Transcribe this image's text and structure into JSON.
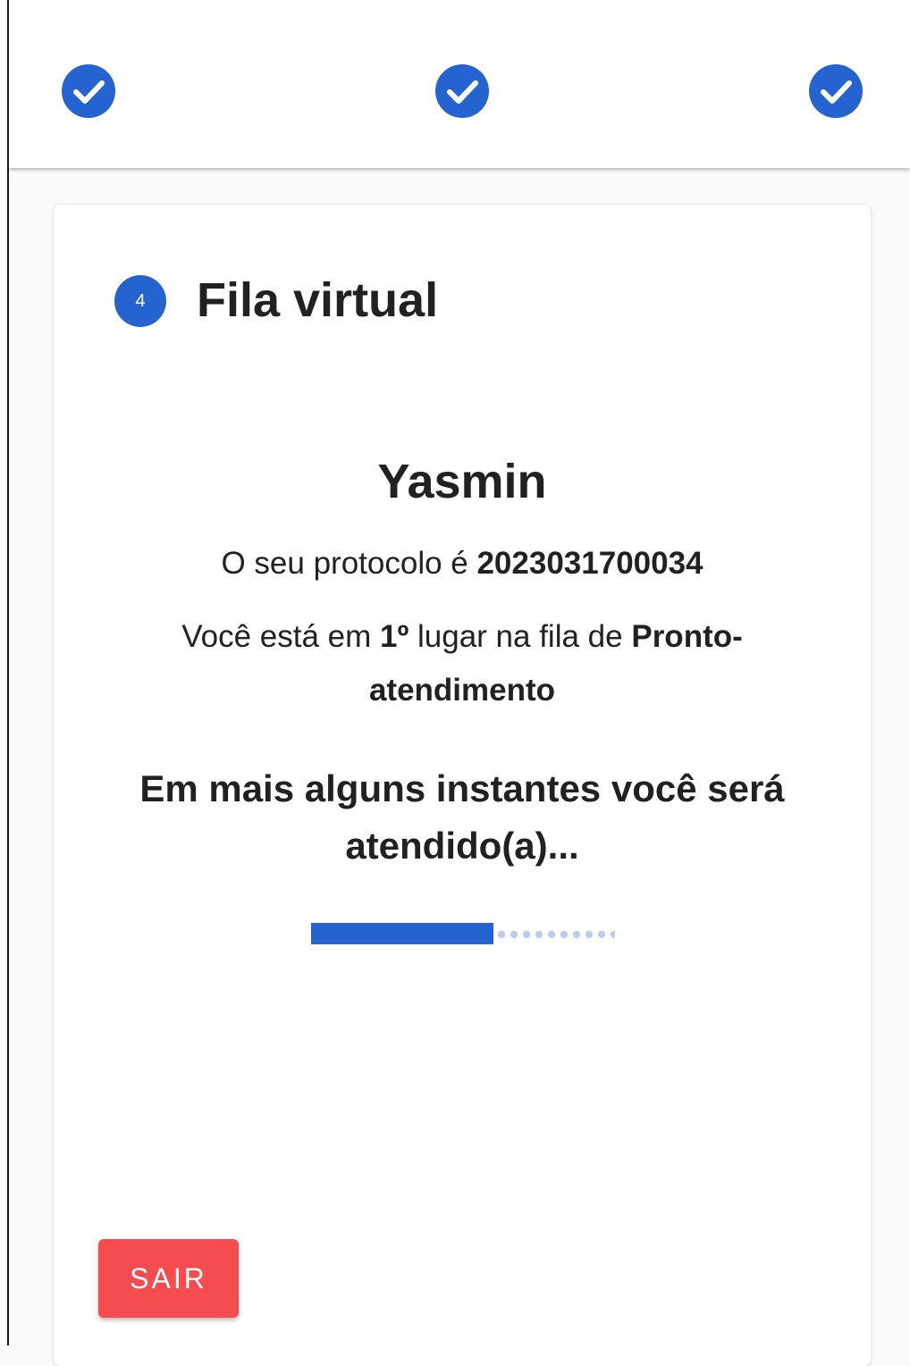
{
  "stepper": {
    "steps": [
      {
        "status": "completed",
        "icon": "check-circle-icon"
      },
      {
        "status": "completed",
        "icon": "check-circle-icon"
      },
      {
        "status": "completed",
        "icon": "check-circle-icon"
      }
    ]
  },
  "card": {
    "step_number": "4",
    "title": "Fila virtual",
    "patient_name": "Yasmin",
    "protocol_prefix": "O seu protocolo é ",
    "protocol_number": "2023031700034",
    "queue_prefix": "Você está em ",
    "queue_position": "1º",
    "queue_middle": " lugar na fila de ",
    "queue_name": "Pronto-atendimento",
    "wait_message": "Em mais alguns instantes você será atendido(a)...",
    "progress": {
      "value": 0.6,
      "buffer": 1.0
    },
    "exit_label": "SAIR"
  },
  "colors": {
    "primary": "#2563d0",
    "danger": "#f44c4f",
    "text": "#212121",
    "background": "#fafafa"
  }
}
